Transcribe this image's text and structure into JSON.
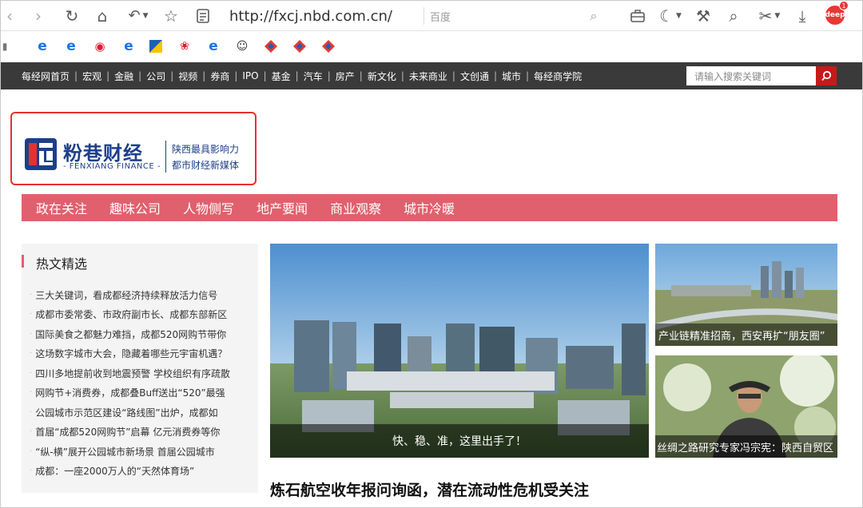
{
  "browser": {
    "url": "http://fxcj.nbd.com.cn/",
    "search_placeholder": "百度",
    "badge_label": "deep",
    "badge_count": "1"
  },
  "site_nav": {
    "links": [
      "每经网首页",
      "宏观",
      "金融",
      "公司",
      "视频",
      "券商",
      "IPO",
      "基金",
      "汽车",
      "房产",
      "新文化",
      "未来商业",
      "文创通",
      "城市",
      "每经商学院"
    ],
    "search_placeholder": "请输入搜索关键词"
  },
  "logo": {
    "name": "粉巷财经",
    "name_en": "- FENXIANG FINANCE -",
    "tagline_1": "陕西最具影响力",
    "tagline_2": "都市财经新媒体"
  },
  "categories": [
    "政在关注",
    "趣味公司",
    "人物侧写",
    "地产要闻",
    "商业观察",
    "城市冷暖"
  ],
  "hot": {
    "title": "热文精选",
    "items": [
      "三大关键词，看成都经济持续释放活力信号",
      "成都市委常委、市政府副市长、成都东部新区",
      "国际美食之都魅力难挡，成都520网购节带你",
      "这场数字城市大会，隐藏着哪些元宇宙机遇？",
      "四川多地提前收到地震预警 学校组织有序疏散",
      "网购节+消费券，成都叠Buff送出“520”最强",
      "公园城市示范区建设“路线图”出炉，成都如",
      "首届“成都520网购节”启幕 亿元消费券等你",
      "“纵-横”展开公园城市新场景 首届公园城市",
      "成都：一座2000万人的“天然体育场”"
    ]
  },
  "feature": {
    "main_caption": "快、稳、准，这里出手了！",
    "side1_caption": "产业链精准招商，西安再扩“朋友圈”",
    "side2_caption": "丝绸之路研究专家冯宗宪：陕西自贸区",
    "headline": "炼石航空收年报问询函，潜在流动性危机受关注"
  }
}
